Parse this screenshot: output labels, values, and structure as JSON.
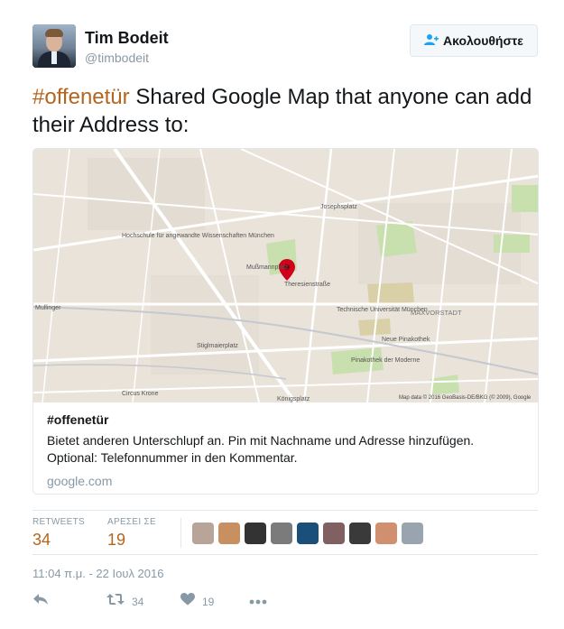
{
  "user": {
    "name": "Tim Bodeit",
    "handle": "@timbodeit"
  },
  "follow_button": {
    "label": "Ακολουθήστε",
    "icon": "add-user-icon"
  },
  "tweet": {
    "hashtag": "#offenetür",
    "text": " Shared Google Map that anyone can add their Address to:"
  },
  "card": {
    "title": "#offenetür",
    "description": "Bietet anderen Unterschlupf an. Pin mit Nachname und Adresse hinzufügen. Optional: Telefonnummer in den Kommentar.",
    "domain": "google.com",
    "map_labels": {
      "station1": "Theresienstraße",
      "station2": "Josephsplatz",
      "station3": "Stiglmaierplatz",
      "station4": "Königsplatz",
      "district": "MAXVORSTADT",
      "uni": "Technische Universität München",
      "school": "Hochschule für angewandte Wissenschaften München",
      "area1": "Mußmannplatz",
      "pinakothek1": "Neue Pinakothek",
      "pinakothek2": "Pinakothek der Moderne",
      "circus": "Circus Krone",
      "street1": "Mullinger",
      "attribution": "Map data © 2016 GeoBasis-DE/BKG (© 2009), Google"
    }
  },
  "stats": {
    "retweets_label": "RETWEETS",
    "retweets_value": "34",
    "likes_label": "ΑΡΕΣΕΙ ΣΕ",
    "likes_value": "19",
    "liker_colors": [
      "#b9a49a",
      "#c89060",
      "#333333",
      "#7b7b7b",
      "#1a4f7a",
      "#806060",
      "#3a3a3a",
      "#d09070",
      "#9aa4ae"
    ]
  },
  "timestamp": "11:04 π.μ. - 22 Ιουλ 2016",
  "actions": {
    "reply_icon": "reply-icon",
    "retweet_icon": "retweet-icon",
    "retweet_count": "34",
    "like_icon": "heart-icon",
    "like_count": "19",
    "more_icon": "more-icon"
  },
  "colors": {
    "accent": "#b5651d",
    "follow_icon": "#1da1f2",
    "muted": "#8899a6"
  }
}
